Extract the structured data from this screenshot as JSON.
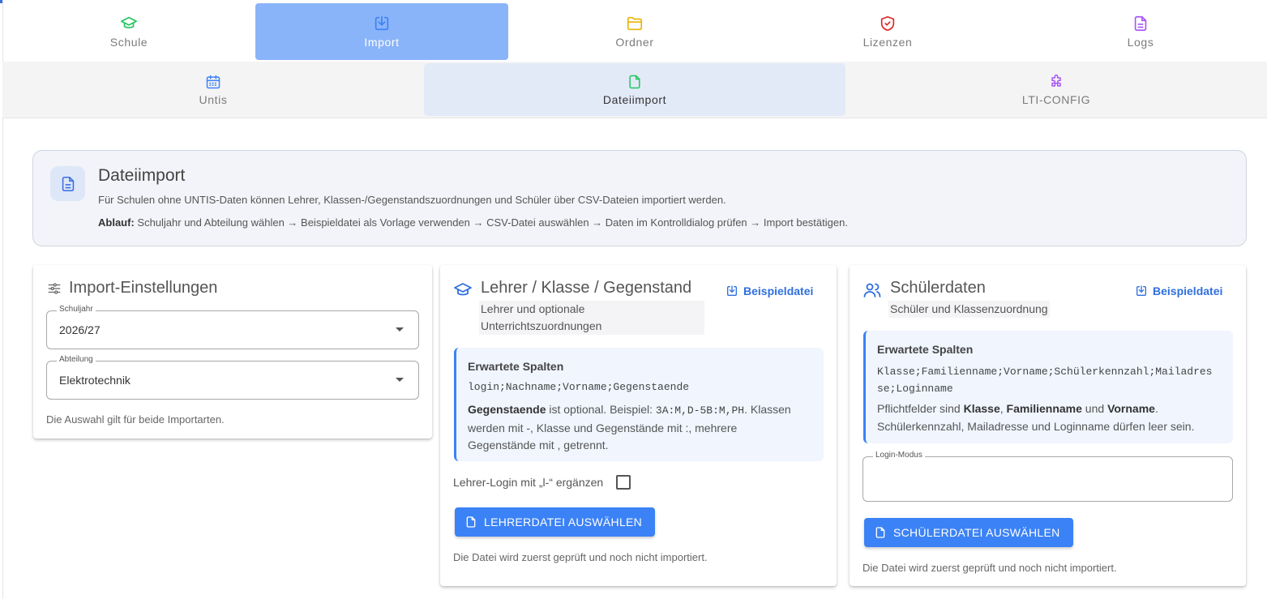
{
  "top_tabs": [
    {
      "label": "Schule",
      "icon": "school-icon",
      "color": "#22c55e"
    },
    {
      "label": "Import",
      "icon": "import-icon",
      "color": "#3b82f6"
    },
    {
      "label": "Ordner",
      "icon": "folder-icon",
      "color": "#eab308"
    },
    {
      "label": "Lizenzen",
      "icon": "shield-icon",
      "color": "#dc2626"
    },
    {
      "label": "Logs",
      "icon": "log-file-icon",
      "color": "#a855f7"
    }
  ],
  "sub_tabs": [
    {
      "label": "Untis",
      "icon": "calendar-icon",
      "color": "#3b82f6"
    },
    {
      "label": "Dateiimport",
      "icon": "file-icon",
      "color": "#22c55e"
    },
    {
      "label": "LTI-CONFIG",
      "icon": "puzzle-icon",
      "color": "#a855f7"
    }
  ],
  "info": {
    "title": "Dateiimport",
    "description": "Für Schulen ohne UNTIS-Daten können Lehrer, Klassen-/Gegenstandszuordnungen und Schüler über CSV-Dateien importiert werden.",
    "flow_label": "Ablauf:",
    "flow_text": " Schuljahr und Abteilung wählen → Beispieldatei als Vorlage verwenden → CSV-Datei auswählen → Daten im Kontrolldialog prüfen → Import bestätigen."
  },
  "settings": {
    "title": "Import-Einstellungen",
    "schuljahr_label": "Schuljahr",
    "schuljahr_value": "2026/27",
    "abteilung_label": "Abteilung",
    "abteilung_value": "Elektrotechnik",
    "note": "Die Auswahl gilt für beide Importarten."
  },
  "teacher": {
    "title": "Lehrer / Klasse / Gegenstand",
    "subtitle_line1": "Lehrer und optionale",
    "subtitle_line2": "Unterrichtszuordnungen",
    "sample_label": "Beispieldatei",
    "expected_title": "Erwartete Spalten",
    "columns": "login;Nachname;Vorname;Gegenstaende",
    "desc_bold": "Gegenstaende",
    "desc_1": " ist optional. Beispiel: ",
    "desc_example": "3A:M,D-5B:M,PH",
    "desc_2": ". Klassen",
    "desc_line2": "werden mit -, Klasse und Gegenstände mit :, mehrere",
    "desc_line3": "Gegenstände mit , getrennt.",
    "checkbox_label": "Lehrer-Login mit „l-“ ergänzen",
    "button_label": "LEHRERDATEI AUSWÄHLEN",
    "note": "Die Datei wird zuerst geprüft und noch nicht importiert."
  },
  "student": {
    "title": "Schülerdaten",
    "subtitle": "Schüler und Klassenzuordnung",
    "sample_label": "Beispieldatei",
    "expected_title": "Erwartete Spalten",
    "columns_line1": "Klasse;Familienname;Vorname;Schülerkennzahl;Mailadres",
    "columns_line2": "se;Loginname",
    "req_1": "Pflichtfelder sind ",
    "req_b1": "Klasse",
    "req_2": ", ",
    "req_b2": "Familienname",
    "req_3": " und ",
    "req_b3": "Vorname",
    "req_4": ".",
    "req_line2": "Schülerkennzahl, Mailadresse und Loginname dürfen leer sein.",
    "login_mode_label": "Login-Modus",
    "login_mode_value": "",
    "button_label": "SCHÜLERDATEI AUSWÄHLEN",
    "note": "Die Datei wird zuerst geprüft und noch nicht importiert."
  }
}
